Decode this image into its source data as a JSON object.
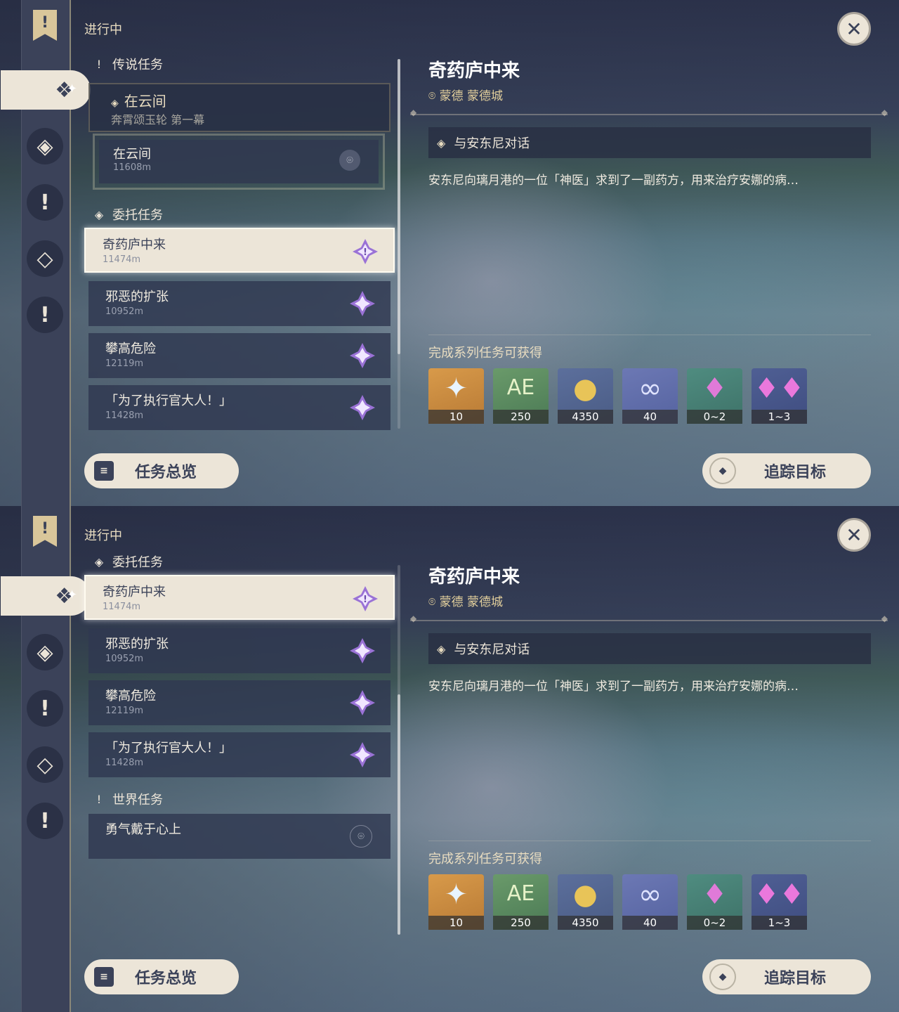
{
  "close_icon": "close-icon",
  "screens": [
    {
      "header": "进行中",
      "sections": {
        "legend": {
          "label": "传说任务",
          "quest_title": "在云间",
          "quest_sub": "奔霄颂玉轮 第一幕",
          "step_title": "在云间",
          "step_distance": "11608m"
        },
        "commission": {
          "label": "委托任务",
          "items": [
            {
              "title": "奇药庐中来",
              "distance": "11474m"
            },
            {
              "title": "邪恶的扩张",
              "distance": "10952m"
            },
            {
              "title": "攀高危险",
              "distance": "12119m"
            },
            {
              "title": "「为了执行官大人！」",
              "distance": "11428m"
            }
          ]
        }
      },
      "buttons": {
        "overview": "任务总览",
        "track": "追踪目标"
      }
    },
    {
      "header": "进行中",
      "sections": {
        "commission": {
          "label": "委托任务",
          "items": [
            {
              "title": "奇药庐中来",
              "distance": "11474m"
            },
            {
              "title": "邪恶的扩张",
              "distance": "10952m"
            },
            {
              "title": "攀高危险",
              "distance": "12119m"
            },
            {
              "title": "「为了执行官大人！」",
              "distance": "11428m"
            }
          ]
        },
        "world": {
          "label": "世界任务",
          "items": [
            {
              "title": "勇气戴于心上"
            }
          ]
        }
      },
      "buttons": {
        "overview": "任务总览",
        "track": "追踪目标"
      }
    }
  ],
  "detail": {
    "title": "奇药庐中来",
    "location": "蒙德 蒙德城",
    "objective": "与安东尼对话",
    "description": "安东尼向璃月港的一位「神医」求到了一副药方，用来治疗安娜的病…",
    "rewards_label": "完成系列任务可获得",
    "rewards": [
      {
        "icon": "primogem-icon",
        "count": "10"
      },
      {
        "icon": "adventure-exp-icon",
        "count": "250"
      },
      {
        "icon": "mora-icon",
        "count": "4350"
      },
      {
        "icon": "friendship-exp-icon",
        "count": "40"
      },
      {
        "icon": "crystal-small-icon",
        "count": "0~2"
      },
      {
        "icon": "crystal-large-icon",
        "count": "1~3"
      }
    ]
  },
  "colors": {
    "accent": "#ece5d8",
    "panel": "#3b4259",
    "location": "#e2cf9c"
  }
}
